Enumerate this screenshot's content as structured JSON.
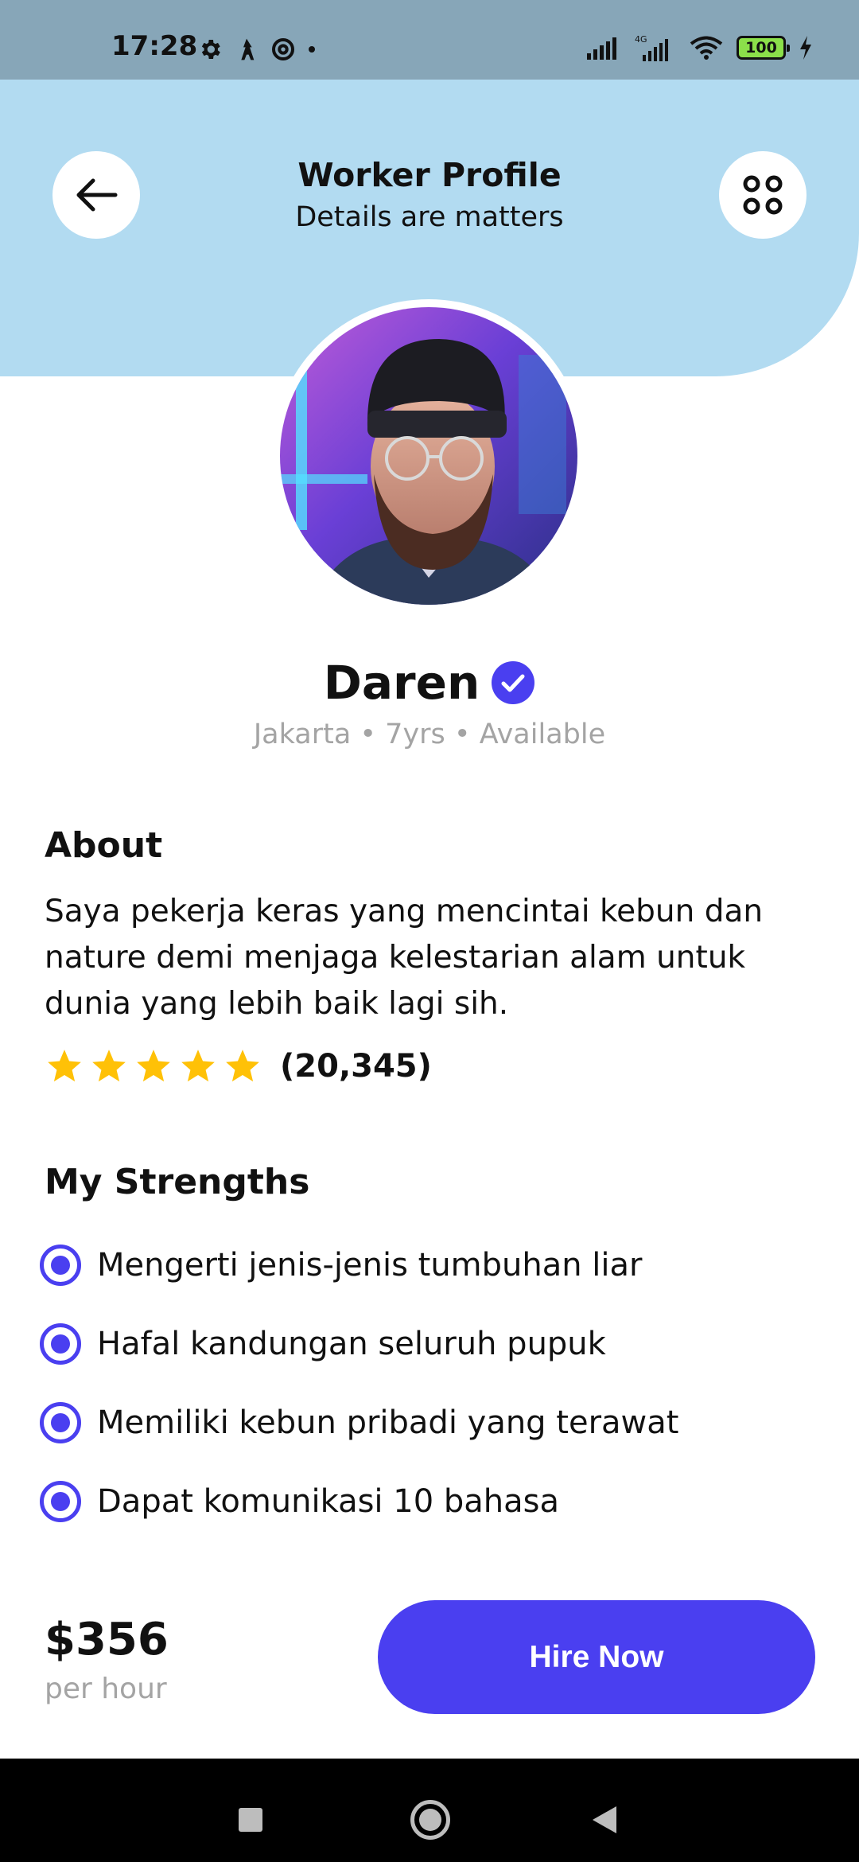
{
  "status_bar": {
    "time": "17:28",
    "battery": "100",
    "network": "4G",
    "icons_left": [
      "gear-icon",
      "wizard-icon",
      "at-icon",
      "dot-icon"
    ],
    "icons_right": [
      "signal-icon",
      "signal-4g-icon",
      "wifi-icon",
      "battery-icon",
      "charging-icon"
    ]
  },
  "header": {
    "title": "Worker Profile",
    "subtitle": "Details are matters",
    "back_icon": "arrow-left-icon",
    "menu_icon": "grid-dots-icon"
  },
  "profile": {
    "name": "Daren",
    "verified_icon": "verified-check-icon",
    "meta": "Jakarta • 7yrs • Available"
  },
  "about": {
    "title": "About",
    "text": "Saya pekerja keras yang mencintai kebun dan nature demi menjaga kelestarian alam untuk dunia yang lebih baik lagi sih.",
    "rating_stars": 5,
    "review_count": "(20,345)"
  },
  "strengths": {
    "title": "My Strengths",
    "items": [
      "Mengerti jenis-jenis tumbuhan liar",
      "Hafal kandungan seluruh pupuk",
      "Memiliki kebun pribadi yang terawat",
      "Dapat komunikasi 10 bahasa"
    ]
  },
  "footer": {
    "price": "$356",
    "price_unit": "per hour",
    "hire_label": "Hire Now"
  },
  "colors": {
    "accent": "#4a3ff0",
    "header_bg": "#b2dbf1",
    "status_bar_bg": "#87a6b8",
    "star": "#ffc107",
    "muted_text": "#a4a4a4"
  }
}
